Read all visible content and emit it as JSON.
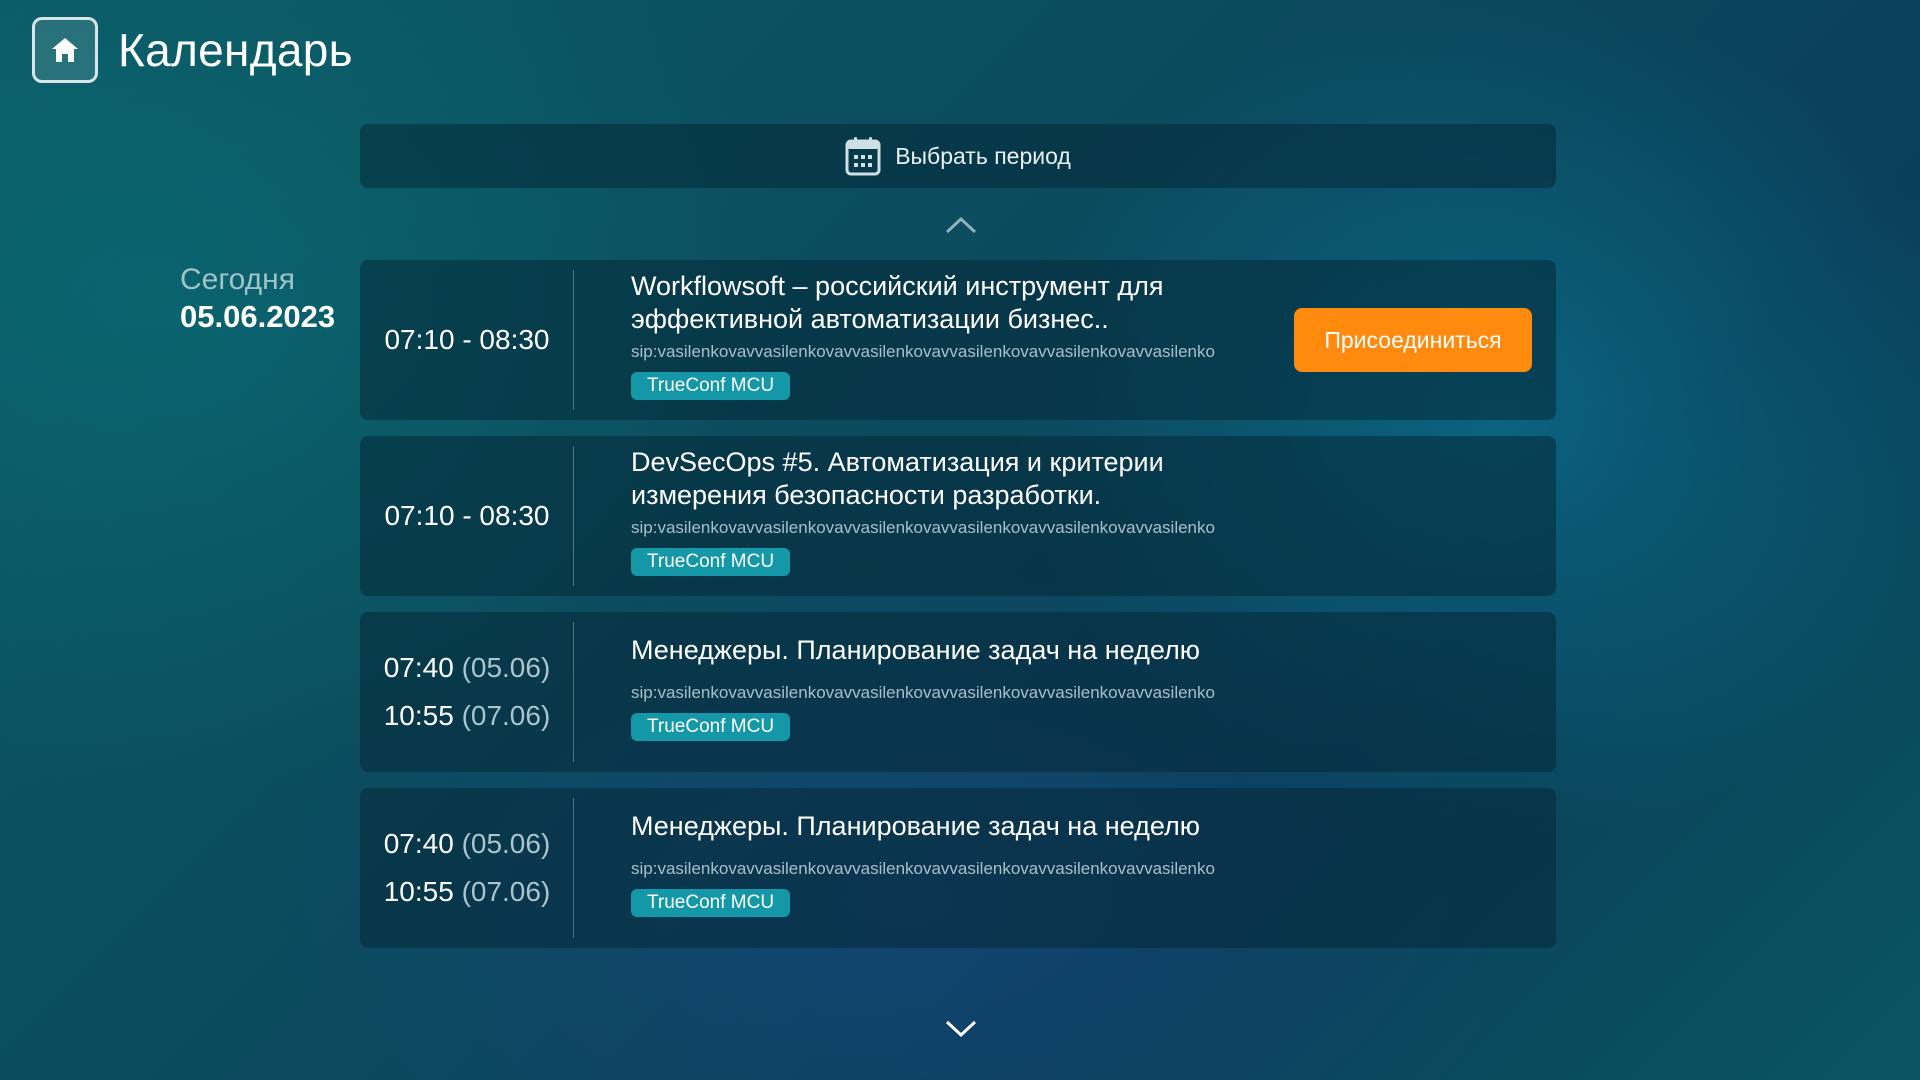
{
  "header": {
    "title": "Календарь",
    "home_icon": "home-icon"
  },
  "period": {
    "label": "Выбрать период",
    "icon": "calendar-icon"
  },
  "day": {
    "name": "Сегодня",
    "date": "05.06.2023"
  },
  "colors": {
    "accent": "#ff8a0d",
    "tag": "#1497a6"
  },
  "events": [
    {
      "time": "07:10 - 08:30",
      "title_line1": "Workflowsoft – российский инструмент для",
      "title_line2": "эффективной автоматизации бизнес..",
      "sip": "sip:vasilenkovavvasilenkovavvasilenkovavvasilenkovavvasilenkovavvasilenko",
      "tag": "TrueConf MCU",
      "join_label": "Присоединиться"
    },
    {
      "time": "07:10 - 08:30",
      "title_line1": "DevSecOps #5. Автоматизация и критерии",
      "title_line2": "измерения безопасности разработки.",
      "sip": "sip:vasilenkovavvasilenkovavvasilenkovavvasilenkovavvasilenkovavvasilenko",
      "tag": "TrueConf MCU"
    },
    {
      "start_time": "07:40",
      "start_date": "(05.06)",
      "end_time": "10:55",
      "end_date": "(07.06)",
      "title": "Менеджеры. Планирование задач на неделю",
      "sip": "sip:vasilenkovavvasilenkovavvasilenkovavvasilenkovavvasilenkovavvasilenko",
      "tag": "TrueConf MCU"
    },
    {
      "start_time": "07:40",
      "start_date": "(05.06)",
      "end_time": "10:55",
      "end_date": "(07.06)",
      "title": "Менеджеры. Планирование задач на неделю",
      "sip": "sip:vasilenkovavvasilenkovavvasilenkovavvasilenkovavvasilenkovavvasilenko",
      "tag": "TrueConf MCU"
    }
  ]
}
